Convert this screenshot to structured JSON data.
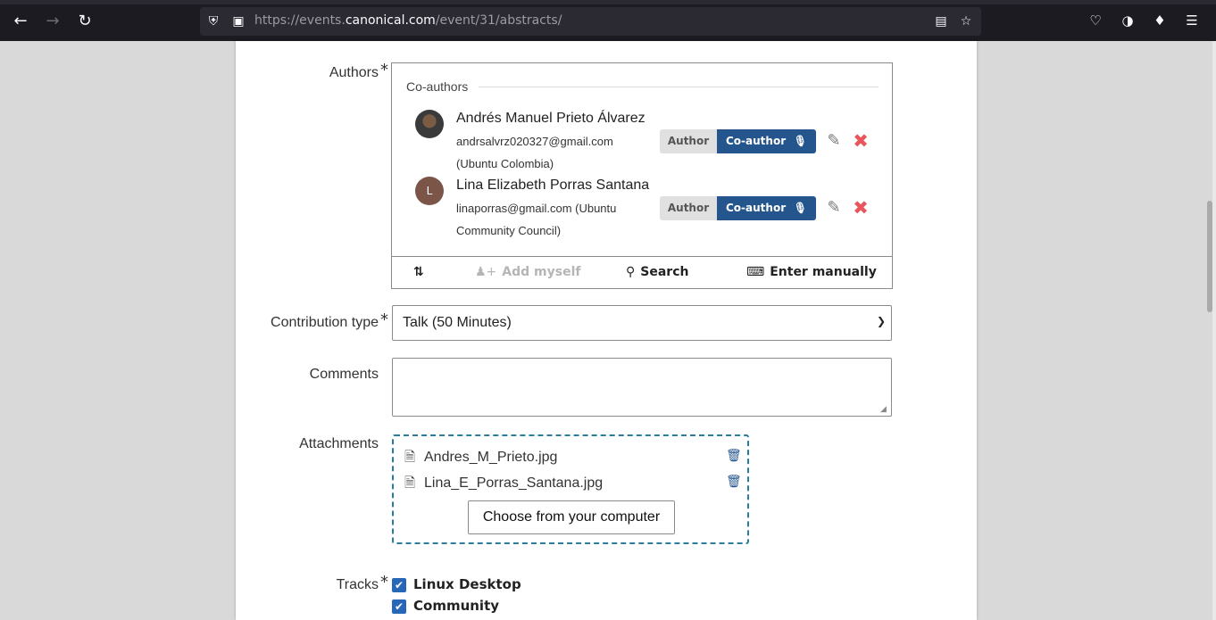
{
  "browser": {
    "url_prefix": "https://events.",
    "url_host": "canonical.com",
    "url_path": "/event/31/abstracts/"
  },
  "form": {
    "authors": {
      "label": "Authors",
      "required_mark": "*",
      "section_title": "Co-authors",
      "people": [
        {
          "name": "Andrés Manuel Prieto Álvarez",
          "email": "andrsalvrz020327@gmail.com",
          "affiliation": "(Ubuntu Colombia)",
          "avatar_letter": "",
          "role_author_label": "Author",
          "role_coauthor_label": "Co-author",
          "selected_role": "Co-author"
        },
        {
          "name": "Lina Elizabeth Porras Santana",
          "email_line1": "linaporras@gmail.com (Ubuntu",
          "email_line2": "Community Council)",
          "avatar_letter": "L",
          "role_author_label": "Author",
          "role_coauthor_label": "Co-author",
          "selected_role": "Co-author"
        }
      ],
      "footer": {
        "sort_icon": "sort-numeric-icon",
        "add_myself": "Add myself",
        "search": "Search",
        "enter_manually": "Enter manually"
      }
    },
    "contribution_type": {
      "label": "Contribution type",
      "required_mark": "*",
      "value": "Talk (50 Minutes)"
    },
    "comments": {
      "label": "Comments",
      "value": ""
    },
    "attachments": {
      "label": "Attachments",
      "files": [
        "Andres_M_Prieto.jpg",
        "Lina_E_Porras_Santana.jpg"
      ],
      "choose_button": "Choose from your computer"
    },
    "tracks": {
      "label": "Tracks",
      "required_mark": "*",
      "items": [
        {
          "label": "Linux Desktop",
          "checked": true
        },
        {
          "label": "Community",
          "checked": true
        }
      ]
    }
  },
  "colors": {
    "accent": "#24568d",
    "remove": "#e8555b",
    "dropzone_border": "#2a7d9c",
    "checkbox": "#2767b8"
  }
}
